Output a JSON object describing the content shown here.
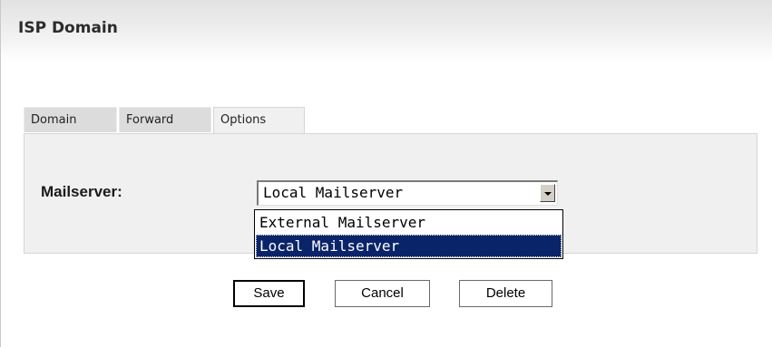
{
  "header": {
    "title": "ISP Domain"
  },
  "tabs": [
    {
      "label": "Domain",
      "active": false
    },
    {
      "label": "Forward",
      "active": false
    },
    {
      "label": "Options",
      "active": true
    }
  ],
  "form": {
    "mailserver_label": "Mailserver:",
    "mailserver_value": "Local Mailserver",
    "mailserver_options": [
      {
        "label": "External Mailserver",
        "selected": false
      },
      {
        "label": "Local Mailserver",
        "selected": true
      }
    ]
  },
  "buttons": {
    "save_label": "Save",
    "cancel_label": "Cancel",
    "delete_label": "Delete"
  },
  "colors": {
    "selection_highlight": "#0a246a",
    "tab_panel_background": "#f0f0f0",
    "inactive_tab_background": "#dcdcdc"
  },
  "icons": {
    "select_arrow": "chevron-down-icon"
  }
}
